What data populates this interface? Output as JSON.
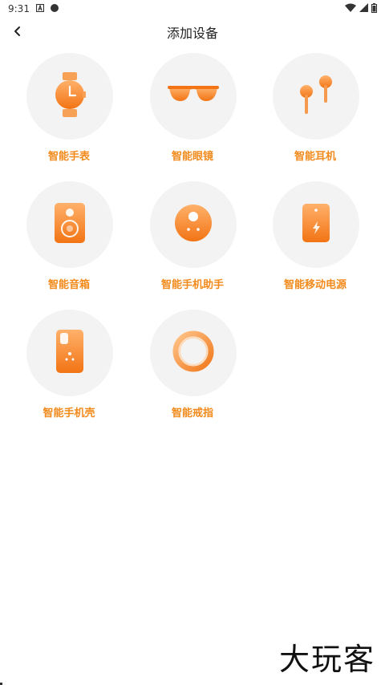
{
  "status_bar": {
    "time": "9:31",
    "icons": [
      "notification-a-icon",
      "circle-icon",
      "wifi-icon",
      "signal-icon",
      "battery-icon"
    ]
  },
  "header": {
    "back_icon": "chevron-left-icon",
    "title": "添加设备"
  },
  "devices": [
    {
      "label": "智能手表",
      "icon": "watch-icon"
    },
    {
      "label": "智能眼镜",
      "icon": "glasses-icon"
    },
    {
      "label": "智能耳机",
      "icon": "earphones-icon"
    },
    {
      "label": "智能音箱",
      "icon": "speaker-icon"
    },
    {
      "label": "智能手机助手",
      "icon": "phone-assistant-icon"
    },
    {
      "label": "智能移动电源",
      "icon": "power-bank-icon"
    },
    {
      "label": "智能手机壳",
      "icon": "phone-case-icon"
    },
    {
      "label": "智能戒指",
      "icon": "ring-icon"
    }
  ],
  "watermark": "大玩客",
  "colors": {
    "accent": "#f28a1c",
    "circle_bg": "#f3f3f3"
  }
}
